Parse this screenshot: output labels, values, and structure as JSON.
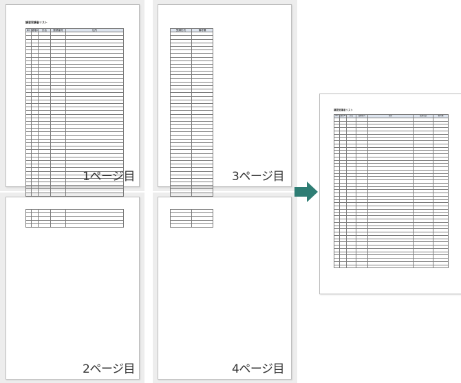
{
  "pages": {
    "p1": {
      "label": "1ページ目"
    },
    "p2": {
      "label": "2ページ目"
    },
    "p3": {
      "label": "3ページ目"
    },
    "p4": {
      "label": "4ページ目"
    }
  },
  "sheet": {
    "title": "講習受講者リスト",
    "headers": [
      "NO",
      "顧客ID",
      "氏名",
      "郵便番号",
      "住所",
      "受講形式",
      "備考欄"
    ]
  },
  "colors": {
    "arrow": "#2e7d74",
    "panel": "#ededed",
    "header": "#dde4ee"
  }
}
